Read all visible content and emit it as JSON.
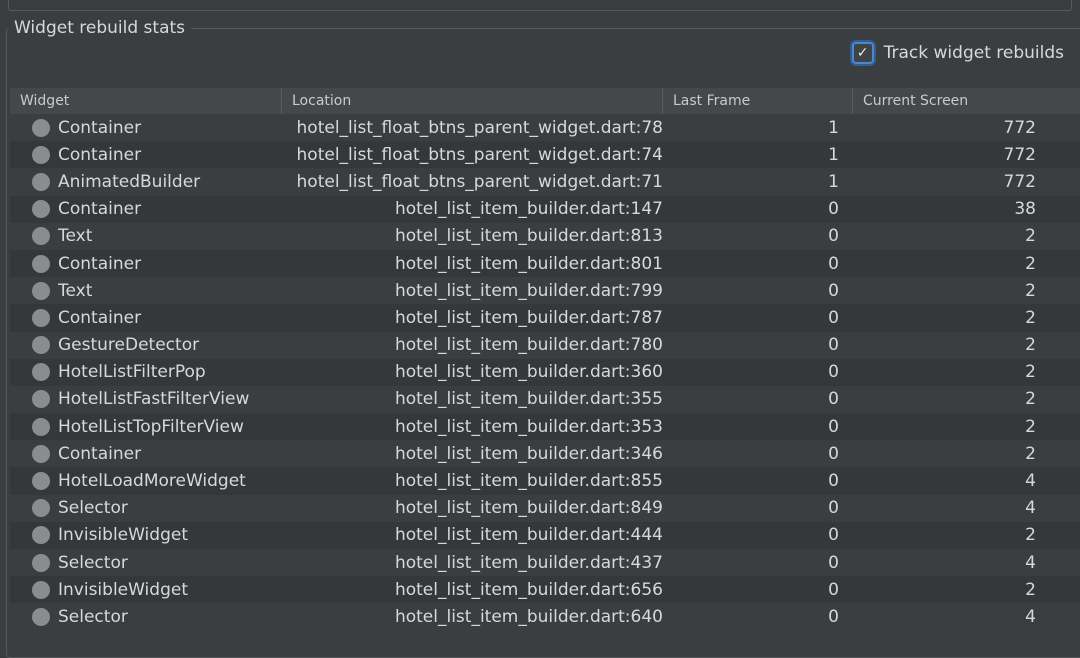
{
  "panel": {
    "title": "Widget rebuild stats",
    "track_label": "Track widget rebuilds",
    "track_checked": true
  },
  "table": {
    "columns": [
      "Widget",
      "Location",
      "Last Frame",
      "Current Screen"
    ],
    "rows": [
      {
        "widget": "Container",
        "location": "hotel_list_float_btns_parent_widget.dart:78",
        "last": "1",
        "current": "772"
      },
      {
        "widget": "Container",
        "location": "hotel_list_float_btns_parent_widget.dart:74",
        "last": "1",
        "current": "772"
      },
      {
        "widget": "AnimatedBuilder",
        "location": "hotel_list_float_btns_parent_widget.dart:71",
        "last": "1",
        "current": "772"
      },
      {
        "widget": "Container",
        "location": "hotel_list_item_builder.dart:147",
        "last": "0",
        "current": "38"
      },
      {
        "widget": "Text",
        "location": "hotel_list_item_builder.dart:813",
        "last": "0",
        "current": "2"
      },
      {
        "widget": "Container",
        "location": "hotel_list_item_builder.dart:801",
        "last": "0",
        "current": "2"
      },
      {
        "widget": "Text",
        "location": "hotel_list_item_builder.dart:799",
        "last": "0",
        "current": "2"
      },
      {
        "widget": "Container",
        "location": "hotel_list_item_builder.dart:787",
        "last": "0",
        "current": "2"
      },
      {
        "widget": "GestureDetector",
        "location": "hotel_list_item_builder.dart:780",
        "last": "0",
        "current": "2"
      },
      {
        "widget": "HotelListFilterPop",
        "location": "hotel_list_item_builder.dart:360",
        "last": "0",
        "current": "2"
      },
      {
        "widget": "HotelListFastFilterView",
        "location": "hotel_list_item_builder.dart:355",
        "last": "0",
        "current": "2"
      },
      {
        "widget": "HotelListTopFilterView",
        "location": "hotel_list_item_builder.dart:353",
        "last": "0",
        "current": "2"
      },
      {
        "widget": "Container",
        "location": "hotel_list_item_builder.dart:346",
        "last": "0",
        "current": "2"
      },
      {
        "widget": "HotelLoadMoreWidget",
        "location": "hotel_list_item_builder.dart:855",
        "last": "0",
        "current": "4"
      },
      {
        "widget": "Selector",
        "location": "hotel_list_item_builder.dart:849",
        "last": "0",
        "current": "4"
      },
      {
        "widget": "InvisibleWidget",
        "location": "hotel_list_item_builder.dart:444",
        "last": "0",
        "current": "2"
      },
      {
        "widget": "Selector",
        "location": "hotel_list_item_builder.dart:437",
        "last": "0",
        "current": "4"
      },
      {
        "widget": "InvisibleWidget",
        "location": "hotel_list_item_builder.dart:656",
        "last": "0",
        "current": "2"
      },
      {
        "widget": "Selector",
        "location": "hotel_list_item_builder.dart:640",
        "last": "0",
        "current": "4"
      }
    ]
  },
  "colors": {
    "background": "#3b3e40",
    "row_alt": "#353839",
    "header": "#45484a",
    "checkbox_accent": "#4b87c9",
    "dot": "#8a8d90"
  }
}
